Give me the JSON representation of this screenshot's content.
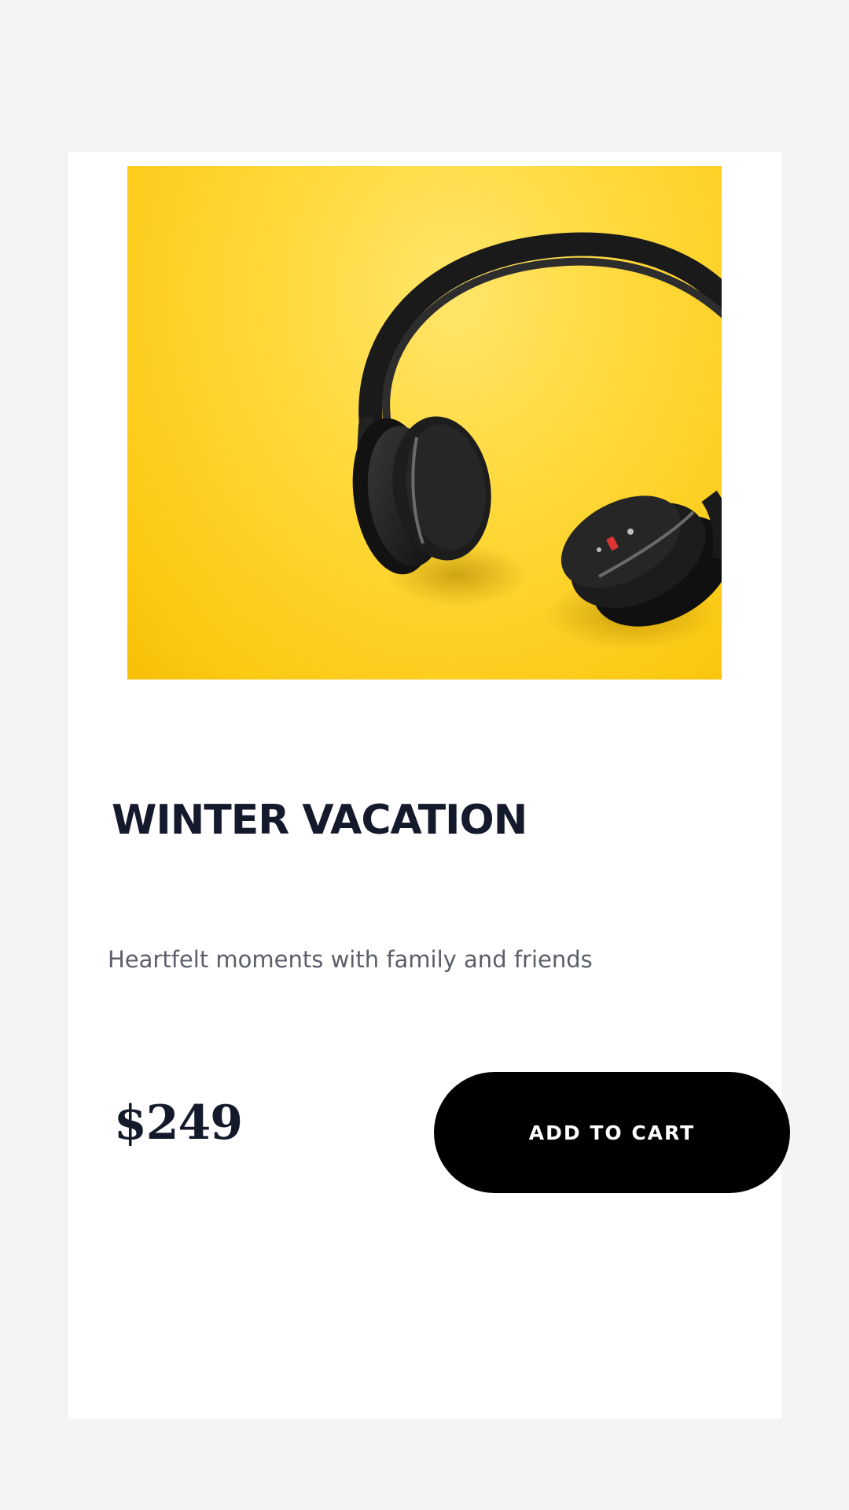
{
  "product": {
    "image_subject": "headphones-on-yellow-background",
    "title": "WINTER VACATION",
    "description": "Heartfelt moments with family and friends",
    "price": "$249",
    "add_to_cart_label": "ADD TO CART"
  },
  "colors": {
    "page_background": "#f3f4f6",
    "card_background": "#ffffff",
    "image_background": "#fcd52a",
    "title": "#141a2b",
    "description": "#5a5f68",
    "button_background": "#000000",
    "button_text": "#ffffff"
  }
}
